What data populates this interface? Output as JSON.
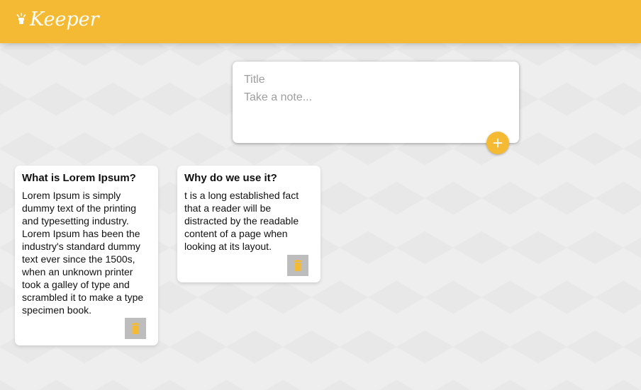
{
  "app": {
    "title": "Keeper",
    "logo_icon": "lightbulb-icon",
    "accent_color": "#f5ba33"
  },
  "create_note": {
    "title_placeholder": "Title",
    "content_placeholder": "Take a note...",
    "add_icon": "plus-icon"
  },
  "notes": [
    {
      "title": "What is Lorem Ipsum?",
      "content": "Lorem Ipsum is simply dummy text of the printing and typesetting industry. Lorem Ipsum has been the industry's standard dummy text ever since the 1500s, when an unknown printer took a galley of type and scrambled it to make a type specimen book.",
      "delete_icon": "trash-icon"
    },
    {
      "title": "Why do we use it?",
      "content": "t is a long established fact that a reader will be distracted by the readable content of a page when looking at its layout.",
      "delete_icon": "trash-icon"
    }
  ]
}
